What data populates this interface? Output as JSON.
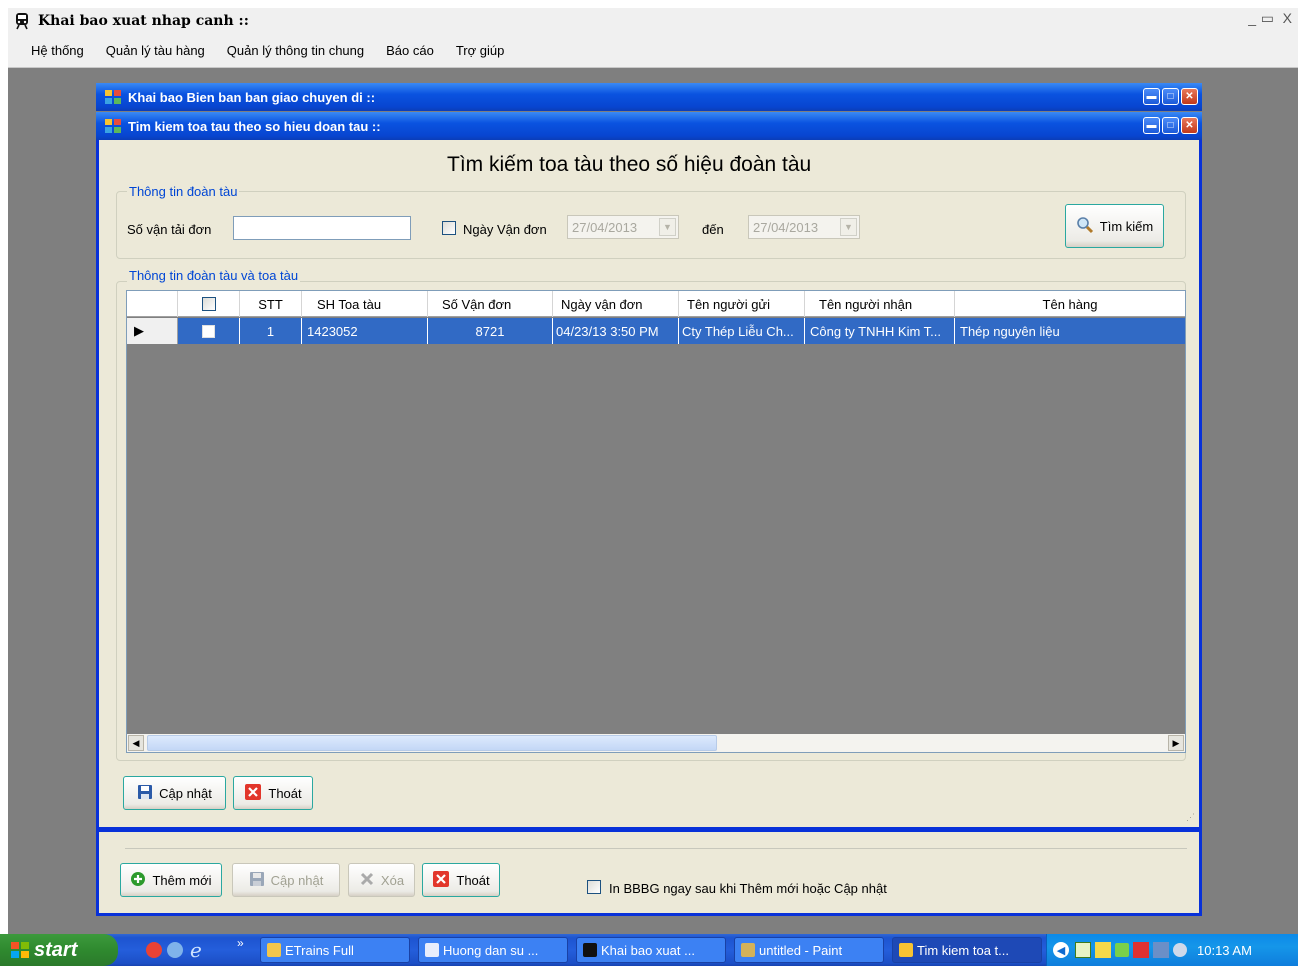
{
  "app": {
    "title": "Khai bao xuat nhap canh ::",
    "menu": [
      "Hệ thống",
      "Quản lý tàu hàng",
      "Quản lý thông tin chung",
      "Báo cáo",
      "Trợ giúp"
    ]
  },
  "back_window": {
    "title": "Khai bao Bien ban ban giao chuyen di ::",
    "buttons": {
      "add": "Thêm mới",
      "update": "Cập nhật",
      "delete": "Xóa",
      "exit": "Thoát"
    },
    "print_checkbox_label": "In BBBG ngay sau khi Thêm mới  hoặc Cập nhật"
  },
  "front_window": {
    "title": "Tim kiem toa tau theo so hieu doan tau ::",
    "heading": "Tìm kiếm toa tàu theo số hiệu đoàn tàu",
    "search_group": {
      "legend": "Thông tin đoàn tàu",
      "waybill_label": "Số vận tải đơn",
      "waybill_value": "",
      "date_checkbox_label": "Ngày Vận đơn",
      "date_from": "27/04/2013",
      "to_label": "đến",
      "date_to": "27/04/2013",
      "search_button": "Tìm kiếm"
    },
    "grid_group": {
      "legend": "Thông tin đoàn tàu và toa tàu",
      "columns": [
        "STT",
        "SH Toa tàu",
        "Số Vận đơn",
        "Ngày vận đơn",
        "Tên người gửi",
        "Tên người nhận",
        "Tên hàng"
      ],
      "rows": [
        {
          "stt": "1",
          "sh_toa_tau": "1423052",
          "so_van_don": "8721",
          "ngay_van_don": "04/23/13 3:50 PM",
          "ten_nguoi_gui": "Cty Thép Liễu Ch...",
          "ten_nguoi_nhan": "Công ty TNHH Kim T...",
          "ten_hang": "Thép nguyên liệu"
        }
      ]
    },
    "buttons": {
      "update": "Cập nhật",
      "exit": "Thoát"
    }
  },
  "taskbar": {
    "start": "start",
    "tasks": [
      "ETrains Full",
      "Huong dan su ...",
      "Khai bao xuat ...",
      "untitled - Paint",
      "Tim kiem toa t..."
    ],
    "clock": "10:13 AM"
  }
}
